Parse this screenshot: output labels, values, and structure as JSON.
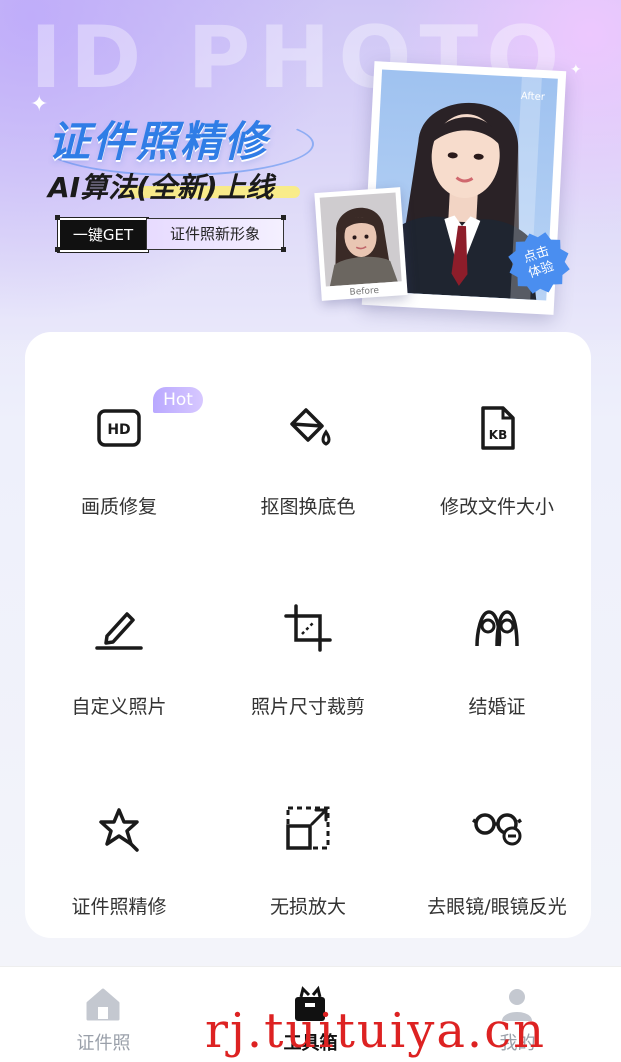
{
  "banner": {
    "bg_word": "ID PHOTO",
    "title": "证件照精修",
    "subtitle": "AI算法(全新)上线",
    "tag_dark": "一键GET",
    "tag_light": "证件照新形象",
    "after_label": "After",
    "before_label": "Before",
    "badge": "点击\n体验"
  },
  "tools": [
    {
      "label": "画质修复",
      "icon": "hd-icon",
      "hot": "Hot"
    },
    {
      "label": "抠图换底色",
      "icon": "paint-bucket-icon"
    },
    {
      "label": "修改文件大小",
      "icon": "kb-file-icon"
    },
    {
      "label": "自定义照片",
      "icon": "pencil-icon"
    },
    {
      "label": "照片尺寸裁剪",
      "icon": "crop-icon"
    },
    {
      "label": "结婚证",
      "icon": "couple-icon"
    },
    {
      "label": "证件照精修",
      "icon": "retouch-star-icon"
    },
    {
      "label": "无损放大",
      "icon": "enlarge-icon"
    },
    {
      "label": "去眼镜/眼镜反光",
      "icon": "glasses-remove-icon"
    }
  ],
  "tabbar": {
    "items": [
      {
        "label": "证件照",
        "icon": "home-icon"
      },
      {
        "label": "工具箱",
        "icon": "toolbox-icon",
        "active": true
      },
      {
        "label": "我的",
        "icon": "user-icon"
      }
    ]
  },
  "watermark": "rj.tuituiya.cn",
  "colors": {
    "accent_blue": "#2f7de6",
    "hot_badge": "#c4b4ff",
    "tab_active": "#111111",
    "tab_inactive": "#9aa0aa"
  }
}
